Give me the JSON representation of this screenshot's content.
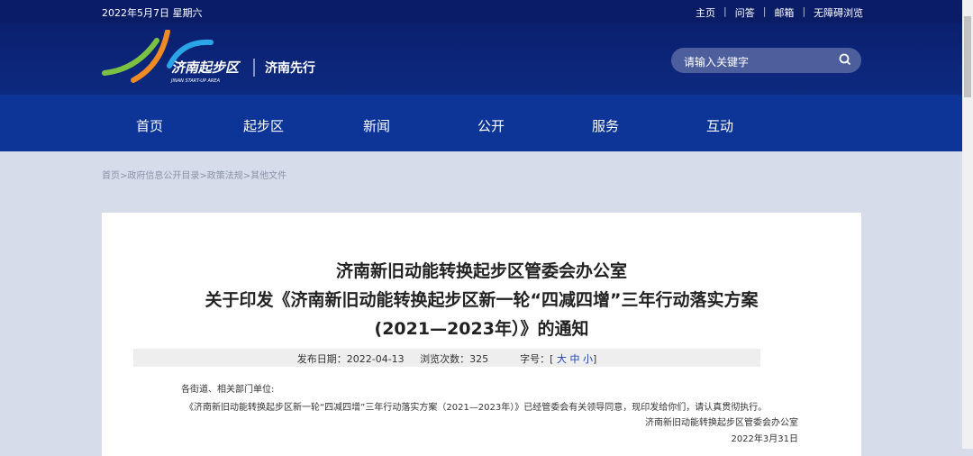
{
  "topbar": {
    "date": "2022年5月7日 星期六",
    "links": [
      "主页",
      "问答",
      "邮箱",
      "无障碍浏览"
    ]
  },
  "logo": {
    "name": "济南起步区",
    "sub": "JINAN START-UP AREA",
    "slogan": "济南先行"
  },
  "search": {
    "placeholder": "请输入关键字"
  },
  "nav": [
    "首页",
    "起步区",
    "新闻",
    "公开",
    "服务",
    "互动"
  ],
  "breadcrumb": "首页>政府信息公开目录>政策法规>其他文件",
  "article": {
    "title_lines": [
      "济南新旧动能转换起步区管委会办公室",
      "关于印发《济南新旧动能转换起步区新一轮“四减四增”三年行动落实方案",
      "(2021—2023年）》的通知"
    ],
    "publish_label": "发布日期：",
    "publish_date": "2022-04-13",
    "views_label": "浏览次数：",
    "views": "325",
    "font_label": "字号：[",
    "font_sizes": [
      "大",
      "中",
      "小"
    ],
    "font_close": "]",
    "salutation": "各街道、相关部门单位:",
    "paragraph": "《济南新旧动能转换起步区新一轮“四减四增”三年行动落实方案（2021—2023年）》已经管委会有关领导同意，现印发给你们，请认真贯彻执行。",
    "signature": "济南新旧动能转换起步区管委会办公室",
    "sign_date": "2022年3月31日"
  }
}
